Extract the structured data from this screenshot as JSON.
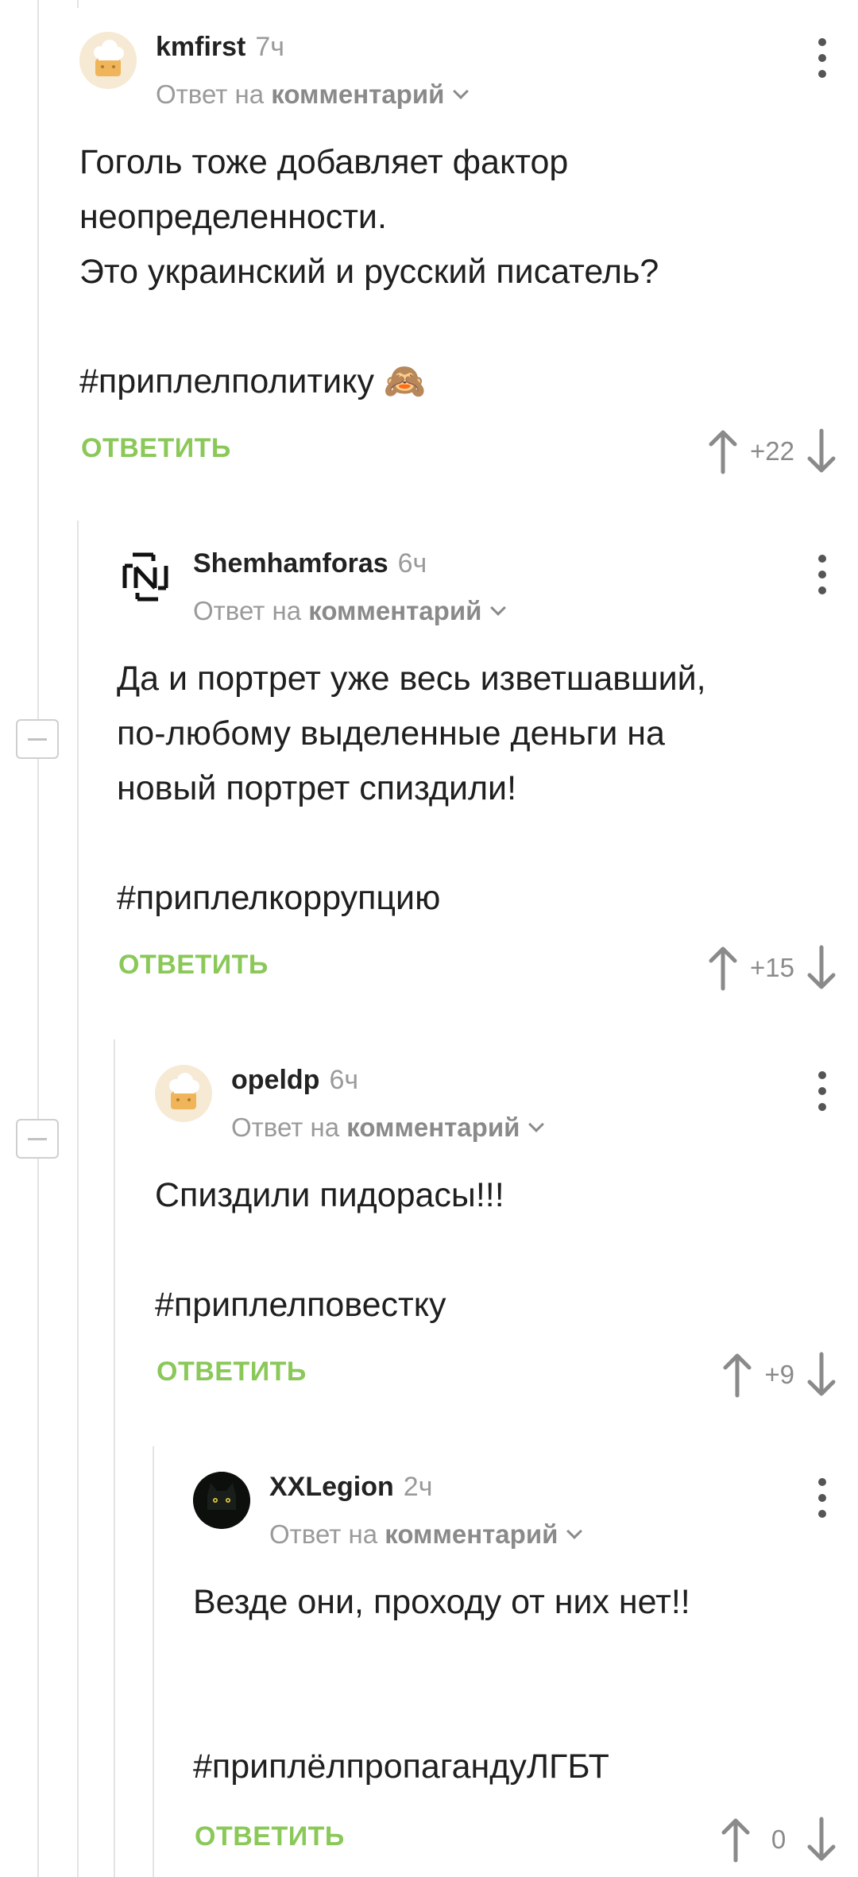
{
  "colors": {
    "accent_green": "#8ac858",
    "muted_text": "#9a9a9a",
    "thread_line": "#e3e3e3"
  },
  "icons": {
    "menu": "more-vertical-icon",
    "upvote": "arrow-up-icon",
    "downvote": "arrow-down-icon",
    "collapse": "minus-box-icon"
  },
  "comments": [
    {
      "author": "kmfirst",
      "time": "7ч",
      "reply_prefix": "Ответ на",
      "reply_target": "комментарий",
      "lines": [
        "Гоголь тоже добавляет фактор",
        "неопределенности.",
        "Это украинский и русский писатель?"
      ],
      "hashtag": "#приплелполитику",
      "emoji": "🙈",
      "reply_label": "ОТВЕТИТЬ",
      "score": "+22"
    },
    {
      "author": "Shemhamforas",
      "time": "6ч",
      "reply_prefix": "Ответ на",
      "reply_target": "комментарий",
      "lines": [
        "Да и портрет уже весь изветшавший,",
        "по-любому выделенные деньги на",
        "новый портрет спиздили!"
      ],
      "hashtag": "#приплелкоррупцию",
      "reply_label": "ОТВЕТИТЬ",
      "score": "+15"
    },
    {
      "author": "opeldp",
      "time": "6ч",
      "reply_prefix": "Ответ на",
      "reply_target": "комментарий",
      "lines": [
        "Спиздили пидорасы!!!"
      ],
      "hashtag": "#приплелповестку",
      "reply_label": "ОТВЕТИТЬ",
      "score": "+9"
    },
    {
      "author": "XXLegion",
      "time": "2ч",
      "reply_prefix": "Ответ на",
      "reply_target": "комментарий",
      "lines": [
        "Везде они, проходу от них нет!!"
      ],
      "hashtag": "#приплёлпропагандуЛГБТ",
      "reply_label": "ОТВЕТИТЬ",
      "score": "0"
    }
  ]
}
